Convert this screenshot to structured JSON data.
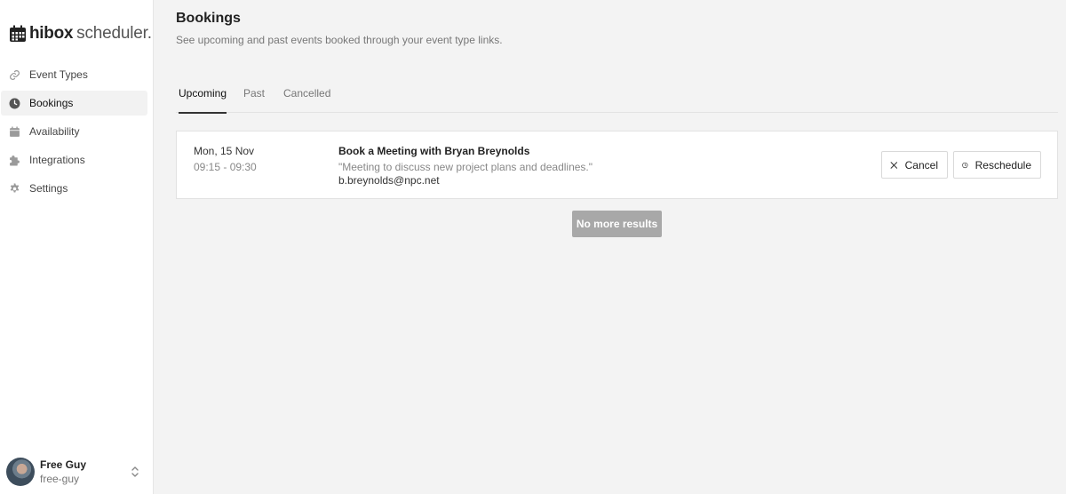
{
  "app": {
    "brand_bold": "hibox",
    "brand_light": "scheduler."
  },
  "sidebar": {
    "items": [
      {
        "label": "Event Types",
        "icon": "link-icon"
      },
      {
        "label": "Bookings",
        "icon": "clock-icon",
        "active": true
      },
      {
        "label": "Availability",
        "icon": "calendar-icon"
      },
      {
        "label": "Integrations",
        "icon": "puzzle-icon"
      },
      {
        "label": "Settings",
        "icon": "gear-icon"
      }
    ]
  },
  "user": {
    "name": "Free Guy",
    "handle": "free-guy"
  },
  "header": {
    "title": "Bookings",
    "subtitle": "See upcoming and past events booked through your event type links."
  },
  "tabs": [
    {
      "label": "Upcoming",
      "active": true
    },
    {
      "label": "Past"
    },
    {
      "label": "Cancelled"
    }
  ],
  "bookings": [
    {
      "date": "Mon, 15 Nov",
      "time": "09:15 - 09:30",
      "title": "Book a Meeting with Bryan Breynolds",
      "description": "\"Meeting to discuss new project plans and deadlines.\"",
      "email": "b.breynolds@npc.net",
      "cancel_label": "Cancel",
      "reschedule_label": "Reschedule"
    }
  ],
  "pagination": {
    "no_more_label": "No more results"
  },
  "colors": {
    "sidebar_bg": "#ffffff",
    "page_bg": "#f3f3f3",
    "active_nav_bg": "#f2f2f2",
    "no_more_bg": "#a8a8a8"
  }
}
